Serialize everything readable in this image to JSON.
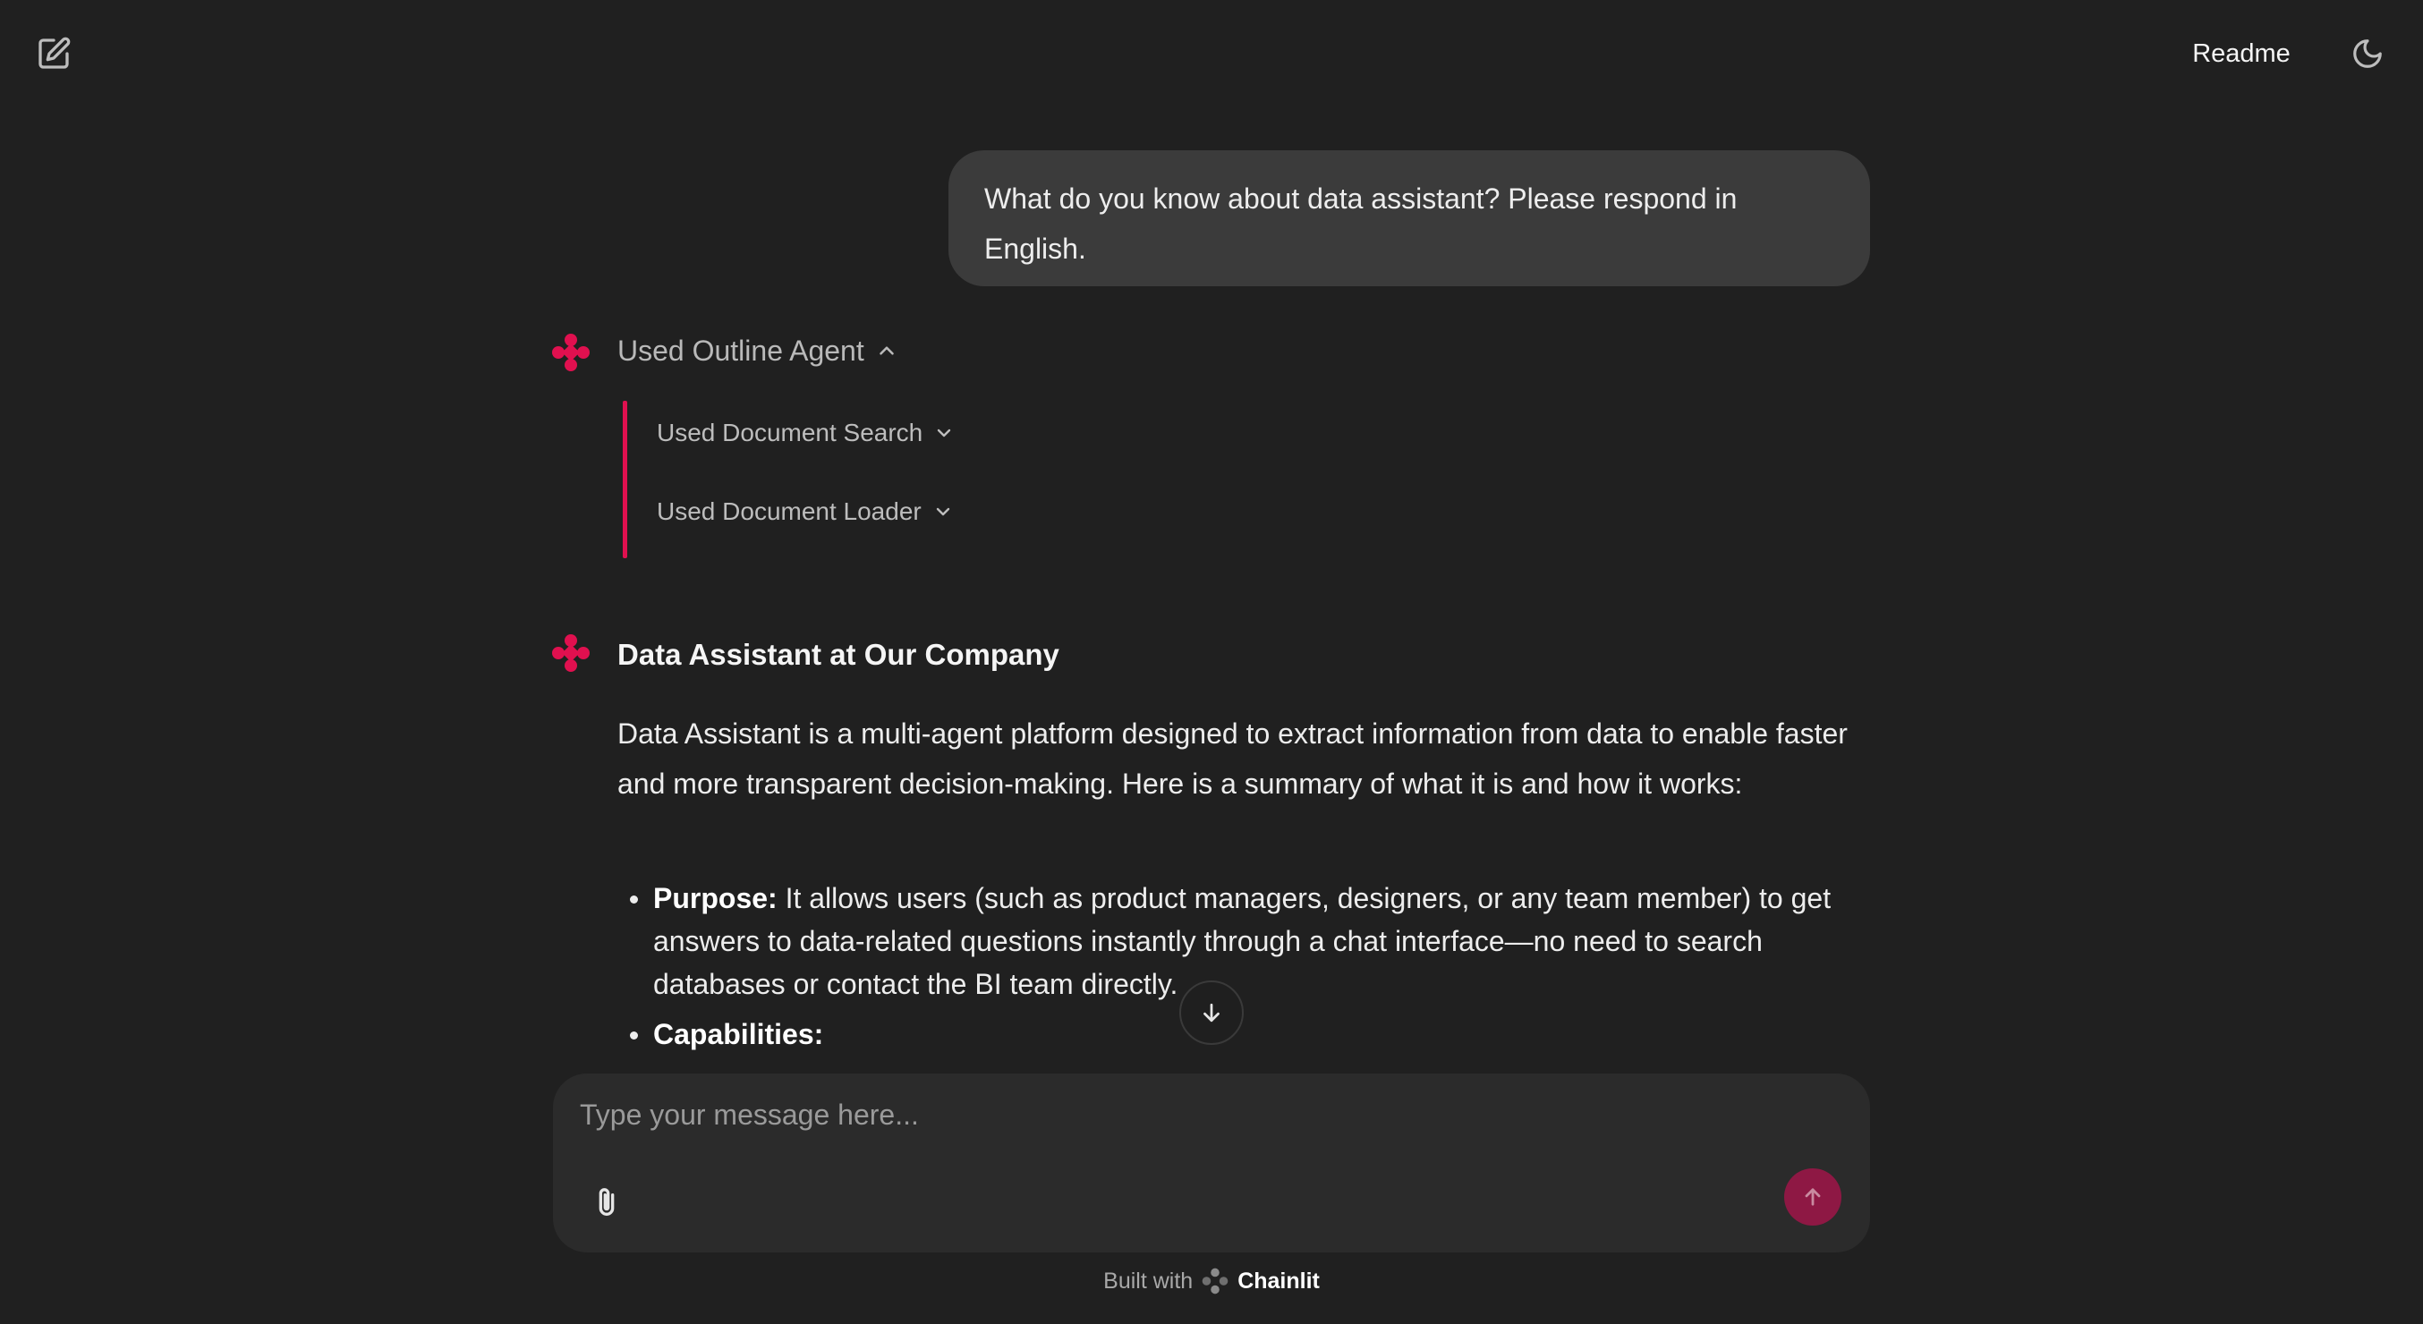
{
  "header": {
    "readme_label": "Readme",
    "new_chat_icon": "edit-square-icon",
    "theme_icon": "moon-icon"
  },
  "conversation": {
    "user_message": "What do you know about data assistant? Please respond in English.",
    "steps": {
      "main_label": "Used Outline Agent",
      "sub_steps": [
        {
          "label": "Used Document Search"
        },
        {
          "label": "Used Document Loader"
        }
      ]
    },
    "answer": {
      "title": "Data Assistant at Our Company",
      "paragraph": "Data Assistant is a multi-agent platform designed to extract information from data to enable faster and more transparent decision-making. Here is a summary of what it is and how it works:",
      "bullets": [
        {
          "term": "Purpose:",
          "text": " It allows users (such as product managers, designers, or any team member) to get answers to data-related questions instantly through a chat interface—no need to search databases or contact the BI team directly."
        },
        {
          "term": "Capabilities:",
          "text": ""
        }
      ]
    }
  },
  "composer": {
    "placeholder": "Type your message here..."
  },
  "footer": {
    "built_with": "Built with",
    "brand": "Chainlit"
  },
  "colors": {
    "background": "#202020",
    "accent": "#e0104f",
    "send_button": "#8e1844",
    "bubble": "#3b3b3b",
    "composer": "#2b2b2b"
  }
}
